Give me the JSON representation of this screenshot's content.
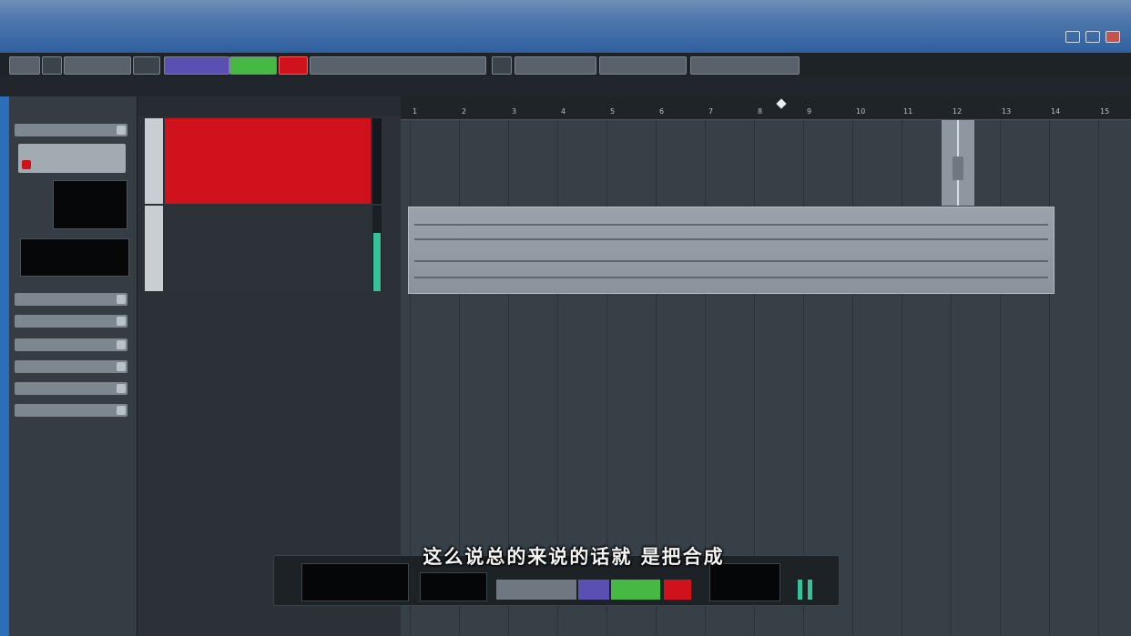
{
  "window": {
    "title_segments": [
      "",
      "",
      "",
      ""
    ],
    "menu": [
      "",
      "",
      "",
      "",
      "",
      "",
      ""
    ]
  },
  "toolbar": {
    "buttons": [
      "",
      "",
      "",
      "",
      "",
      "",
      "",
      "",
      ""
    ]
  },
  "info_line": {
    "fields": [
      "",
      "",
      "",
      "",
      "",
      "",
      ""
    ]
  },
  "inspector": {
    "header": ""
  },
  "tracks": [
    {
      "name": "",
      "controls": "",
      "color": "#d0121c"
    },
    {
      "name": "",
      "controls": "",
      "color": "#2c3238"
    }
  ],
  "ruler": {
    "ticks": [
      "1",
      "2",
      "3",
      "4",
      "5",
      "6",
      "7",
      "8",
      "9",
      "10",
      "11",
      "12",
      "13",
      "14",
      "15"
    ]
  },
  "audio_event": {
    "name": ""
  },
  "subtitle": "这么说总的来说的话就 是把合成",
  "colors": {
    "accent_blue": "#2a6fb7",
    "record_red": "#d0121c",
    "active_green": "#33c29a"
  }
}
